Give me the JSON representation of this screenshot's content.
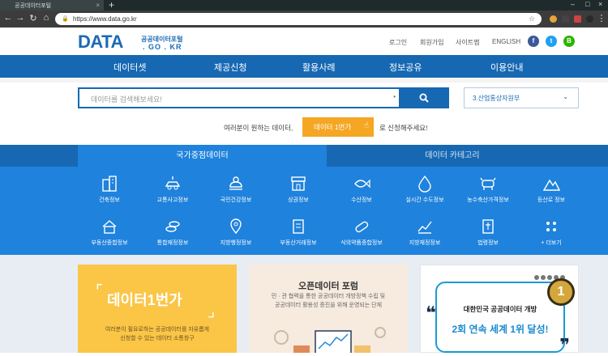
{
  "browser": {
    "tab_title": "공공데이터포털",
    "url": "https://www.data.go.kr"
  },
  "header": {
    "logo_main": "DATA",
    "logo_sub1": "공공데이터포털",
    "logo_sub2": ". GO . KR",
    "links": [
      "로그인",
      "회원가입",
      "사이트맵",
      "ENGLISH"
    ],
    "sns": {
      "facebook": "f",
      "twitter": "t",
      "blog": "B"
    }
  },
  "gnb": {
    "items": [
      "데이터셋",
      "제공신청",
      "활용사례",
      "정보공유",
      "이용안내"
    ]
  },
  "search": {
    "placeholder": "데이터를 검색해보세요!",
    "button_icon": "search-icon",
    "org_select": "3.산업통상자원부"
  },
  "request": {
    "text_before": "여러분이 원하는 데이터,",
    "button": "데이터 1번가",
    "text_after": "로 신청해주세요!"
  },
  "category": {
    "tabs": [
      "국가중점데이터",
      "데이터 카테고리"
    ],
    "items_row1": [
      "건축정보",
      "교통사고정보",
      "국민건강정보",
      "상권정보",
      "수산정보",
      "실시간 수도정보",
      "농수축산가격정보",
      "등산로 정보"
    ],
    "items_row2": [
      "부동산종합정보",
      "통합재정정보",
      "지방행정정보",
      "부동산거래정보",
      "식의약품종합정보",
      "지방재정정보",
      "법령정보",
      "+ 더보기"
    ]
  },
  "cards": {
    "card1": {
      "title": "데이터1번가",
      "desc1": "여러분이 필요로하는 공공데이터를 자유롭게",
      "desc2": "신청할 수 있는 데이터 소통창구"
    },
    "card2": {
      "title": "오픈데이터 포럼",
      "desc1": "민 · 관 협력을 통한 공공데이터 개방정책 수립 및",
      "desc2": "공공데이터 활용성 증진을 위해 운영되는 단체"
    },
    "card3": {
      "line1": "대한민국 공공데이터 개방",
      "line2": "2회 연속 세계 1위 달성!",
      "medal": "1"
    }
  },
  "colors": {
    "brand": "#1768b3",
    "category_bg": "#1f82dc",
    "accent": "#f5a623"
  }
}
